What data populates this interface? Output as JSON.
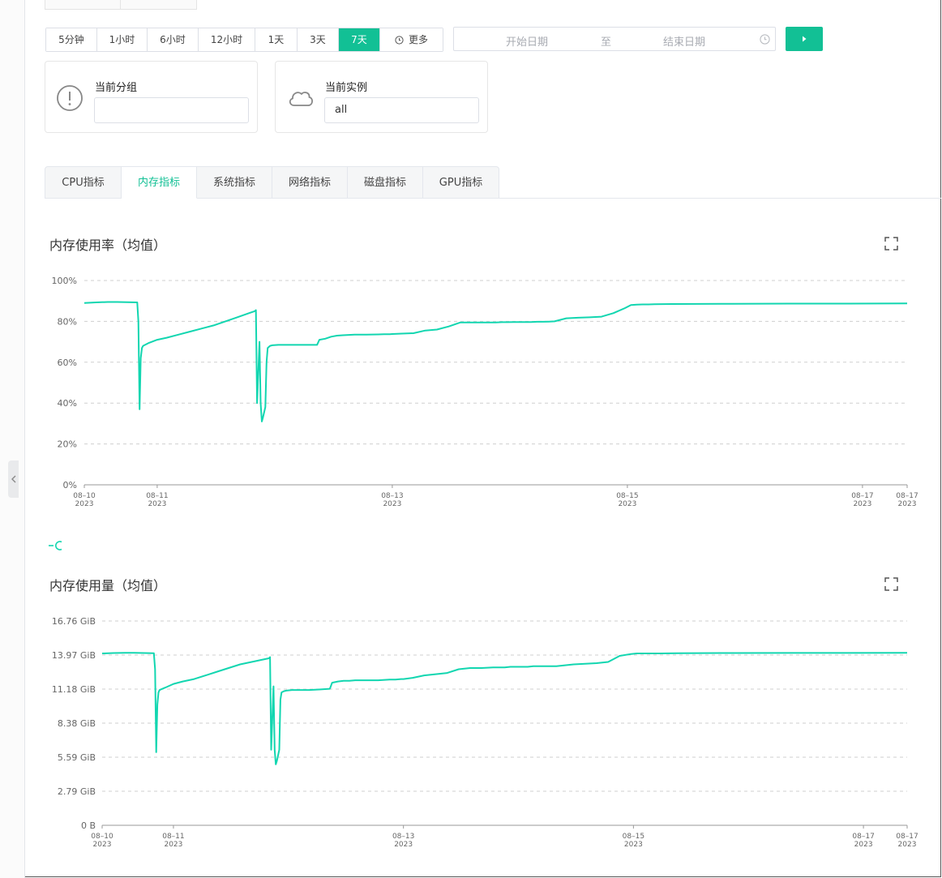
{
  "colors": {
    "accent": "#12c095",
    "series": "#12d6b0"
  },
  "time_range": {
    "buttons": [
      "5分钟",
      "1小时",
      "6小时",
      "12小时",
      "1天",
      "3天",
      "7天"
    ],
    "active": "7天",
    "more_label": "更多"
  },
  "date_range": {
    "start_placeholder": "开始日期",
    "separator": "至",
    "end_placeholder": "结束日期"
  },
  "filters": {
    "group": {
      "label": "当前分组",
      "value": ""
    },
    "instance": {
      "label": "当前实例",
      "value": "all"
    }
  },
  "metric_tabs": {
    "items": [
      "CPU指标",
      "内存指标",
      "系统指标",
      "网络指标",
      "磁盘指标",
      "GPU指标"
    ],
    "active": "内存指标"
  },
  "chart_data": [
    {
      "type": "line",
      "title": "内存使用率（均值）",
      "y_unit": "%",
      "ylim": [
        0,
        100
      ],
      "yticks": [
        "0%",
        "20%",
        "40%",
        "60%",
        "80%",
        "100%"
      ],
      "xticks": [
        {
          "date": "08–10",
          "year": "2023"
        },
        {
          "date": "08–11",
          "year": "2023"
        },
        {
          "date": "08–13",
          "year": "2023"
        },
        {
          "date": "08–15",
          "year": "2023"
        },
        {
          "date": "08–17",
          "year": "2023"
        },
        {
          "date": "08–17",
          "year": "2023"
        }
      ],
      "xtick_days": [
        0,
        0.62,
        2.62,
        4.62,
        6.62,
        7
      ],
      "grid": true,
      "series": [
        {
          "x": [
            0,
            0.1,
            0.2,
            0.28,
            0.45,
            0.46,
            0.47,
            0.48,
            0.49,
            0.5,
            0.55,
            0.62,
            0.7,
            0.8,
            0.9,
            1.0,
            1.1,
            1.2,
            1.3,
            1.4,
            1.45,
            1.46,
            1.47,
            1.49,
            1.5,
            1.51,
            1.52,
            1.54,
            1.55,
            1.56,
            1.58,
            1.6,
            1.65,
            1.75,
            1.8,
            1.9,
            1.98,
            2.0,
            2.05,
            2.1,
            2.15,
            2.2,
            2.3,
            2.4,
            2.5,
            2.55,
            2.6,
            2.62,
            2.7,
            2.8,
            2.9,
            3.0,
            3.1,
            3.2,
            3.3,
            3.4,
            3.5,
            3.55,
            3.6,
            3.65,
            3.7,
            3.75,
            3.8,
            3.85,
            3.9,
            3.95,
            4.0,
            4.1,
            4.2,
            4.3,
            4.4,
            4.5,
            4.6,
            4.65,
            4.7,
            4.75,
            4.8,
            4.85,
            5.0,
            5.5,
            6.0,
            6.5,
            7.0
          ],
          "values": [
            89,
            89.3,
            89.5,
            89.5,
            89.3,
            80,
            37,
            62,
            67,
            68,
            69.5,
            71,
            72,
            73.5,
            75,
            76.5,
            78,
            80,
            82,
            84,
            85,
            85.5,
            40,
            70,
            40,
            31,
            33,
            38,
            60,
            67,
            68,
            68.3,
            68.5,
            68.5,
            68.5,
            68.5,
            68.5,
            71,
            71.5,
            72.5,
            73,
            73.2,
            73.5,
            73.5,
            73.6,
            73.7,
            73.7,
            73.8,
            74,
            74.2,
            75.5,
            76,
            77.5,
            79.5,
            79.5,
            79.5,
            79.5,
            79.6,
            79.6,
            79.7,
            79.7,
            79.7,
            79.7,
            79.8,
            79.8,
            79.9,
            80,
            81.5,
            81.8,
            82,
            82.3,
            84,
            86.5,
            88,
            88.2,
            88.3,
            88.3,
            88.4,
            88.5,
            88.6,
            88.7,
            88.7,
            88.8
          ]
        }
      ]
    },
    {
      "type": "line",
      "title": "内存使用量（均值）",
      "y_unit": "GiB",
      "ylim": [
        0,
        16.76
      ],
      "yticks": [
        "0 B",
        "2.79 GiB",
        "5.59 GiB",
        "8.38 GiB",
        "11.18 GiB",
        "13.97 GiB",
        "16.76 GiB"
      ],
      "xticks": [
        {
          "date": "08–10",
          "year": "2023"
        },
        {
          "date": "08–11",
          "year": "2023"
        },
        {
          "date": "08–13",
          "year": "2023"
        },
        {
          "date": "08–15",
          "year": "2023"
        },
        {
          "date": "08–17",
          "year": "2023"
        },
        {
          "date": "08–17",
          "year": "2023"
        }
      ],
      "xtick_days": [
        0,
        0.62,
        2.62,
        4.62,
        6.62,
        7
      ],
      "grid": true,
      "series": [
        {
          "x": [
            0,
            0.1,
            0.2,
            0.28,
            0.45,
            0.46,
            0.47,
            0.48,
            0.49,
            0.5,
            0.55,
            0.62,
            0.7,
            0.8,
            0.9,
            1.0,
            1.1,
            1.2,
            1.3,
            1.4,
            1.45,
            1.46,
            1.47,
            1.49,
            1.5,
            1.51,
            1.52,
            1.54,
            1.55,
            1.56,
            1.58,
            1.6,
            1.65,
            1.75,
            1.8,
            1.9,
            1.98,
            2.0,
            2.05,
            2.1,
            2.15,
            2.2,
            2.3,
            2.4,
            2.5,
            2.55,
            2.6,
            2.62,
            2.7,
            2.8,
            2.9,
            3.0,
            3.1,
            3.2,
            3.3,
            3.4,
            3.5,
            3.55,
            3.6,
            3.65,
            3.7,
            3.75,
            3.8,
            3.85,
            3.9,
            3.95,
            4.0,
            4.1,
            4.2,
            4.3,
            4.4,
            4.5,
            4.6,
            4.65,
            4.7,
            4.75,
            4.8,
            4.85,
            5.0,
            5.5,
            6.0,
            6.5,
            7.0
          ],
          "values": [
            14.1,
            14.13,
            14.15,
            14.15,
            14.12,
            12.8,
            6.0,
            9.9,
            10.9,
            11.1,
            11.3,
            11.6,
            11.8,
            12.0,
            12.3,
            12.6,
            12.9,
            13.2,
            13.4,
            13.6,
            13.7,
            13.8,
            6.2,
            11.4,
            6.2,
            5.0,
            5.3,
            6.2,
            10.3,
            10.9,
            11.0,
            11.05,
            11.1,
            11.1,
            11.1,
            11.15,
            11.2,
            11.7,
            11.8,
            11.85,
            11.85,
            11.9,
            11.9,
            11.9,
            11.95,
            11.95,
            12.0,
            12.0,
            12.1,
            12.3,
            12.4,
            12.5,
            12.8,
            12.9,
            12.9,
            12.95,
            12.95,
            13.0,
            13.0,
            13.0,
            13.0,
            13.05,
            13.05,
            13.05,
            13.05,
            13.05,
            13.1,
            13.2,
            13.25,
            13.3,
            13.4,
            13.9,
            14.05,
            14.1,
            14.1,
            14.1,
            14.1,
            14.1,
            14.12,
            14.13,
            14.14,
            14.14,
            14.15
          ]
        }
      ]
    }
  ]
}
